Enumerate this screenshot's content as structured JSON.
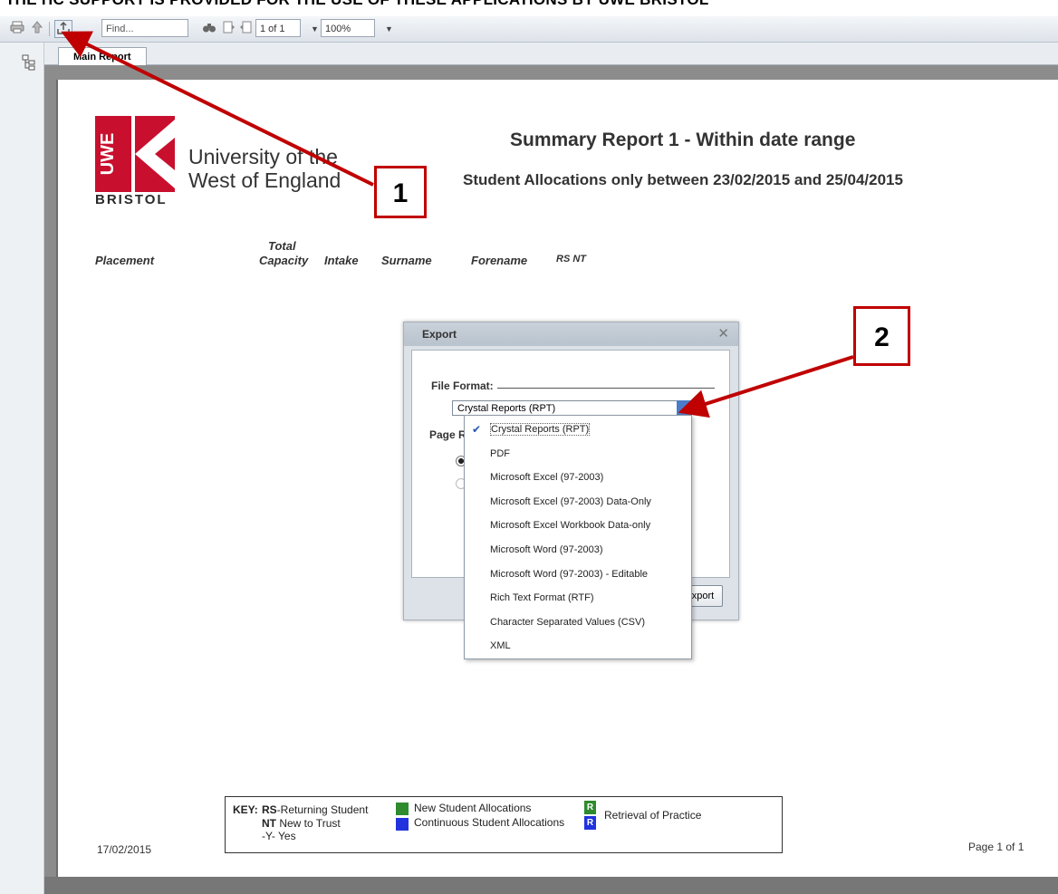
{
  "banner": "THE HC SUPPORT IS PROVIDED FOR THE USE OF THESE APPLICATIONS BY UWE BRISTOL",
  "toolbar": {
    "find_placeholder": "Find...",
    "page_indicator": "1 of 1",
    "zoom": "100%"
  },
  "tab": {
    "label": "Main Report"
  },
  "report": {
    "logo_bristol": "BRISTOL",
    "logo_uwe": "UWE",
    "uni_line1": "University of the",
    "uni_line2": "West of England",
    "title": "Summary Report 1 - Within date range",
    "subtitle": "Student Allocations only between 23/02/2015 and 25/04/2015",
    "columns": {
      "placement": "Placement",
      "total": "Total",
      "capacity": "Capacity",
      "intake": "Intake",
      "surname": "Surname",
      "forename": "Forename",
      "rs_nt": "RS  NT"
    },
    "date": "17/02/2015",
    "page": "Page 1 of 1"
  },
  "dialog": {
    "title": "Export",
    "file_format_label": "File Format:",
    "selected_format": "Crystal Reports (RPT)",
    "page_range_label": "Page R",
    "export_button": "Export",
    "export_button_visible": "xport"
  },
  "dropdown": {
    "options": [
      "Crystal Reports (RPT)",
      "PDF",
      "Microsoft Excel (97-2003)",
      "Microsoft Excel (97-2003) Data-Only",
      "Microsoft Excel Workbook Data-only",
      "Microsoft Word (97-2003)",
      "Microsoft Word (97-2003) - Editable",
      "Rich Text Format (RTF)",
      "Character Separated Values (CSV)",
      "XML"
    ],
    "selected_index": 0
  },
  "key": {
    "label": "KEY:",
    "rs": "RS",
    "rs_text": "-Returning Student",
    "nt": "NT",
    "nt_text": "New to Trust",
    "y": "-Y-",
    "y_text": "Yes",
    "new_alloc": "New Student Allocations",
    "cont_alloc": "Continuous Student Allocations",
    "r_letter": "R",
    "retrieval": "Retrieval of Practice",
    "colors": {
      "green": "#2e8b2e",
      "blue": "#2233dd"
    }
  },
  "callouts": {
    "one": "1",
    "two": "2"
  },
  "colors": {
    "callout_red": "#c00000",
    "uwe_red": "#c8102e"
  }
}
